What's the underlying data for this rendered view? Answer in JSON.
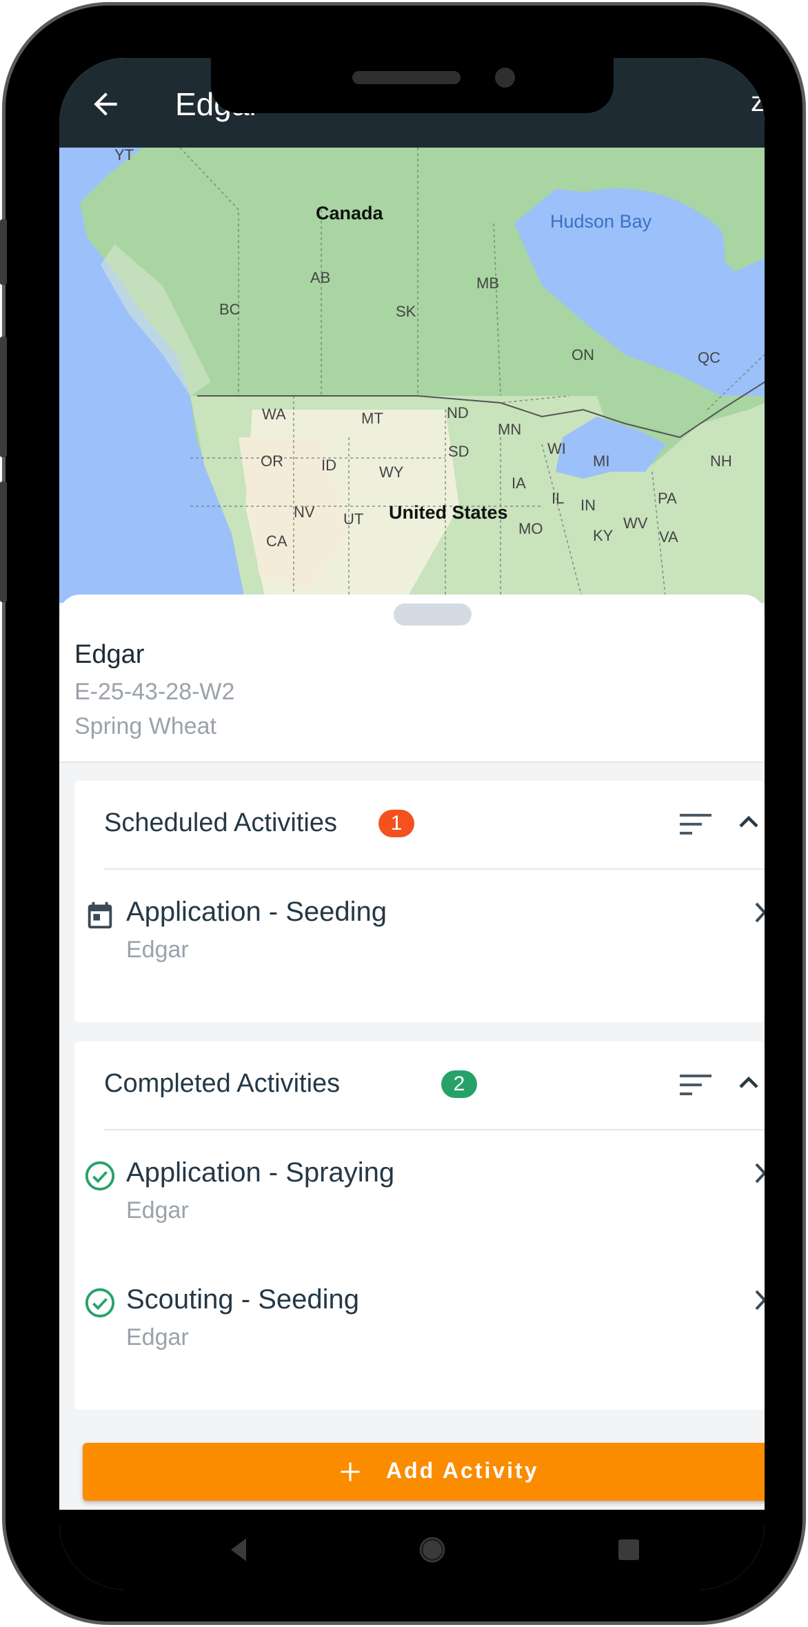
{
  "header": {
    "title": "Edgar",
    "edge_glyph": "z"
  },
  "map": {
    "labels": [
      {
        "text": "YT",
        "kind": "small"
      },
      {
        "text": "Canada",
        "kind": "big"
      },
      {
        "text": "Hudson Bay",
        "kind": "water"
      },
      {
        "text": "AB",
        "kind": "small"
      },
      {
        "text": "MB",
        "kind": "small"
      },
      {
        "text": "BC",
        "kind": "small"
      },
      {
        "text": "SK",
        "kind": "small"
      },
      {
        "text": "ON",
        "kind": "small"
      },
      {
        "text": "QC",
        "kind": "small"
      },
      {
        "text": "WA",
        "kind": "small"
      },
      {
        "text": "MT",
        "kind": "small"
      },
      {
        "text": "ND",
        "kind": "small"
      },
      {
        "text": "MN",
        "kind": "small"
      },
      {
        "text": "WI",
        "kind": "small"
      },
      {
        "text": "MI",
        "kind": "small"
      },
      {
        "text": "NH",
        "kind": "small"
      },
      {
        "text": "OR",
        "kind": "small"
      },
      {
        "text": "ID",
        "kind": "small"
      },
      {
        "text": "SD",
        "kind": "small"
      },
      {
        "text": "WY",
        "kind": "small"
      },
      {
        "text": "IA",
        "kind": "small"
      },
      {
        "text": "NV",
        "kind": "small"
      },
      {
        "text": "UT",
        "kind": "small"
      },
      {
        "text": "United States",
        "kind": "big"
      },
      {
        "text": "IL",
        "kind": "small"
      },
      {
        "text": "IN",
        "kind": "small"
      },
      {
        "text": "PA",
        "kind": "small"
      },
      {
        "text": "MO",
        "kind": "small"
      },
      {
        "text": "WV",
        "kind": "small"
      },
      {
        "text": "KY",
        "kind": "small"
      },
      {
        "text": "VA",
        "kind": "small"
      },
      {
        "text": "CA",
        "kind": "small"
      }
    ]
  },
  "field": {
    "name": "Edgar",
    "legal_land": "E-25-43-28-W2",
    "crop": "Spring Wheat"
  },
  "scheduled": {
    "title": "Scheduled Activities",
    "count": "1",
    "badge_color": "#f4511e",
    "items": [
      {
        "title": "Application - Seeding",
        "subtitle": "Edgar",
        "icon": "calendar-icon"
      }
    ]
  },
  "completed": {
    "title": "Completed Activities",
    "count": "2",
    "badge_color": "#26a269",
    "items": [
      {
        "title": "Application - Spraying",
        "subtitle": "Edgar",
        "icon": "check-circle-icon"
      },
      {
        "title": "Scouting - Seeding",
        "subtitle": "Edgar",
        "icon": "check-circle-icon"
      }
    ]
  },
  "actions": {
    "add_activity": "Add Activity"
  },
  "colors": {
    "appbar": "#1e2b33",
    "accent_orange": "#fb8c00",
    "text_dark": "#243845",
    "text_muted": "#9aa2ab"
  }
}
